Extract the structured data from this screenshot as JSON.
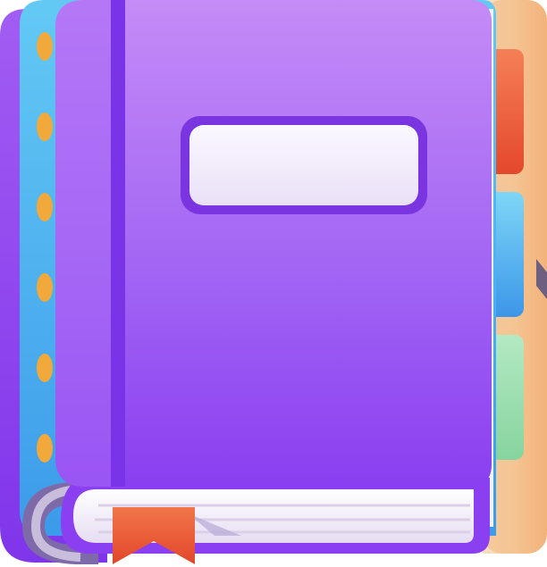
{
  "icon": {
    "name": "notebook-icon",
    "colors": {
      "cover_top": "#C58BF6",
      "cover_bottom": "#8A3FF0",
      "spine": "#7A33E6",
      "back_cover": "#8B3DF0",
      "inner_pages_blue_top": "#63C9F4",
      "inner_pages_blue_bottom": "#3C9BEA",
      "page_block": "#F6F0FC",
      "page_lines": "#D9D0E8",
      "label_fill": "#F3EEFB",
      "label_border": "#7A34E0",
      "ring": "#F0A93A",
      "ring_shadow": "#7E6AA8",
      "tab_orange": "#EE5E33",
      "tab_blue": "#49A6EC",
      "tab_green": "#8ED9A8",
      "back_board": "#F5C08A",
      "bookmark": "#EE5B35"
    },
    "tabs": [
      "orange",
      "blue",
      "green"
    ],
    "ring_count": 6
  }
}
